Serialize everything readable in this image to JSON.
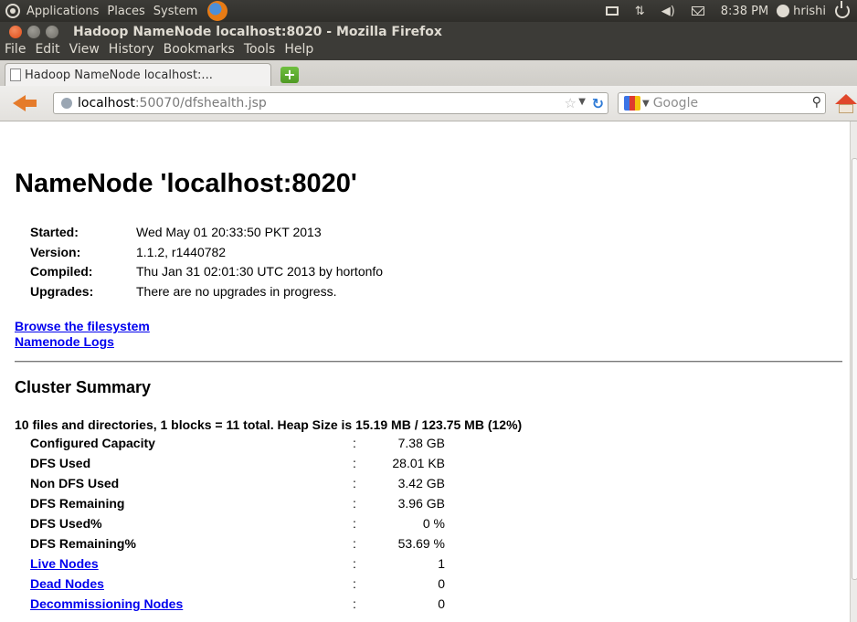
{
  "panel": {
    "menus": [
      "Applications",
      "Places",
      "System"
    ],
    "clock": "8:38 PM",
    "user": "hrishi"
  },
  "window": {
    "title": "Hadoop NameNode localhost:8020 - Mozilla Firefox"
  },
  "menubar": {
    "items": [
      "File",
      "Edit",
      "View",
      "History",
      "Bookmarks",
      "Tools",
      "Help"
    ]
  },
  "tabs": [
    {
      "label": "Hadoop NameNode localhost:..."
    }
  ],
  "navbar": {
    "url_host": "localhost",
    "url_rest": ":50070/dfshealth.jsp",
    "search_placeholder": "Google"
  },
  "page": {
    "title": "NameNode 'localhost:8020'",
    "info": [
      {
        "label": "Started:",
        "value": "Wed May 01 20:33:50 PKT 2013"
      },
      {
        "label": "Version:",
        "value": "1.1.2, r1440782"
      },
      {
        "label": "Compiled:",
        "value": "Thu Jan 31 02:01:30 UTC 2013 by hortonfo"
      },
      {
        "label": "Upgrades:",
        "value": "There are no upgrades in progress."
      }
    ],
    "links": [
      "Browse the filesystem",
      "Namenode Logs"
    ],
    "summary_heading": "Cluster Summary",
    "summary_line": "10 files and directories, 1 blocks = 11 total. Heap Size is 15.19 MB / 123.75 MB (12%)",
    "stats": [
      {
        "key": "Configured Capacity",
        "value": "7.38 GB",
        "link": false
      },
      {
        "key": "DFS Used",
        "value": "28.01 KB",
        "link": false
      },
      {
        "key": "Non DFS Used",
        "value": "3.42 GB",
        "link": false
      },
      {
        "key": "DFS Remaining",
        "value": "3.96 GB",
        "link": false
      },
      {
        "key": "DFS Used%",
        "value": "0 %",
        "link": false
      },
      {
        "key": "DFS Remaining%",
        "value": "53.69 %",
        "link": false
      },
      {
        "key": "Live Nodes",
        "value": "1",
        "link": true
      },
      {
        "key": "Dead Nodes",
        "value": "0",
        "link": true
      },
      {
        "key": "Decommissioning Nodes",
        "value": "0",
        "link": true
      }
    ],
    "separator": ":"
  }
}
